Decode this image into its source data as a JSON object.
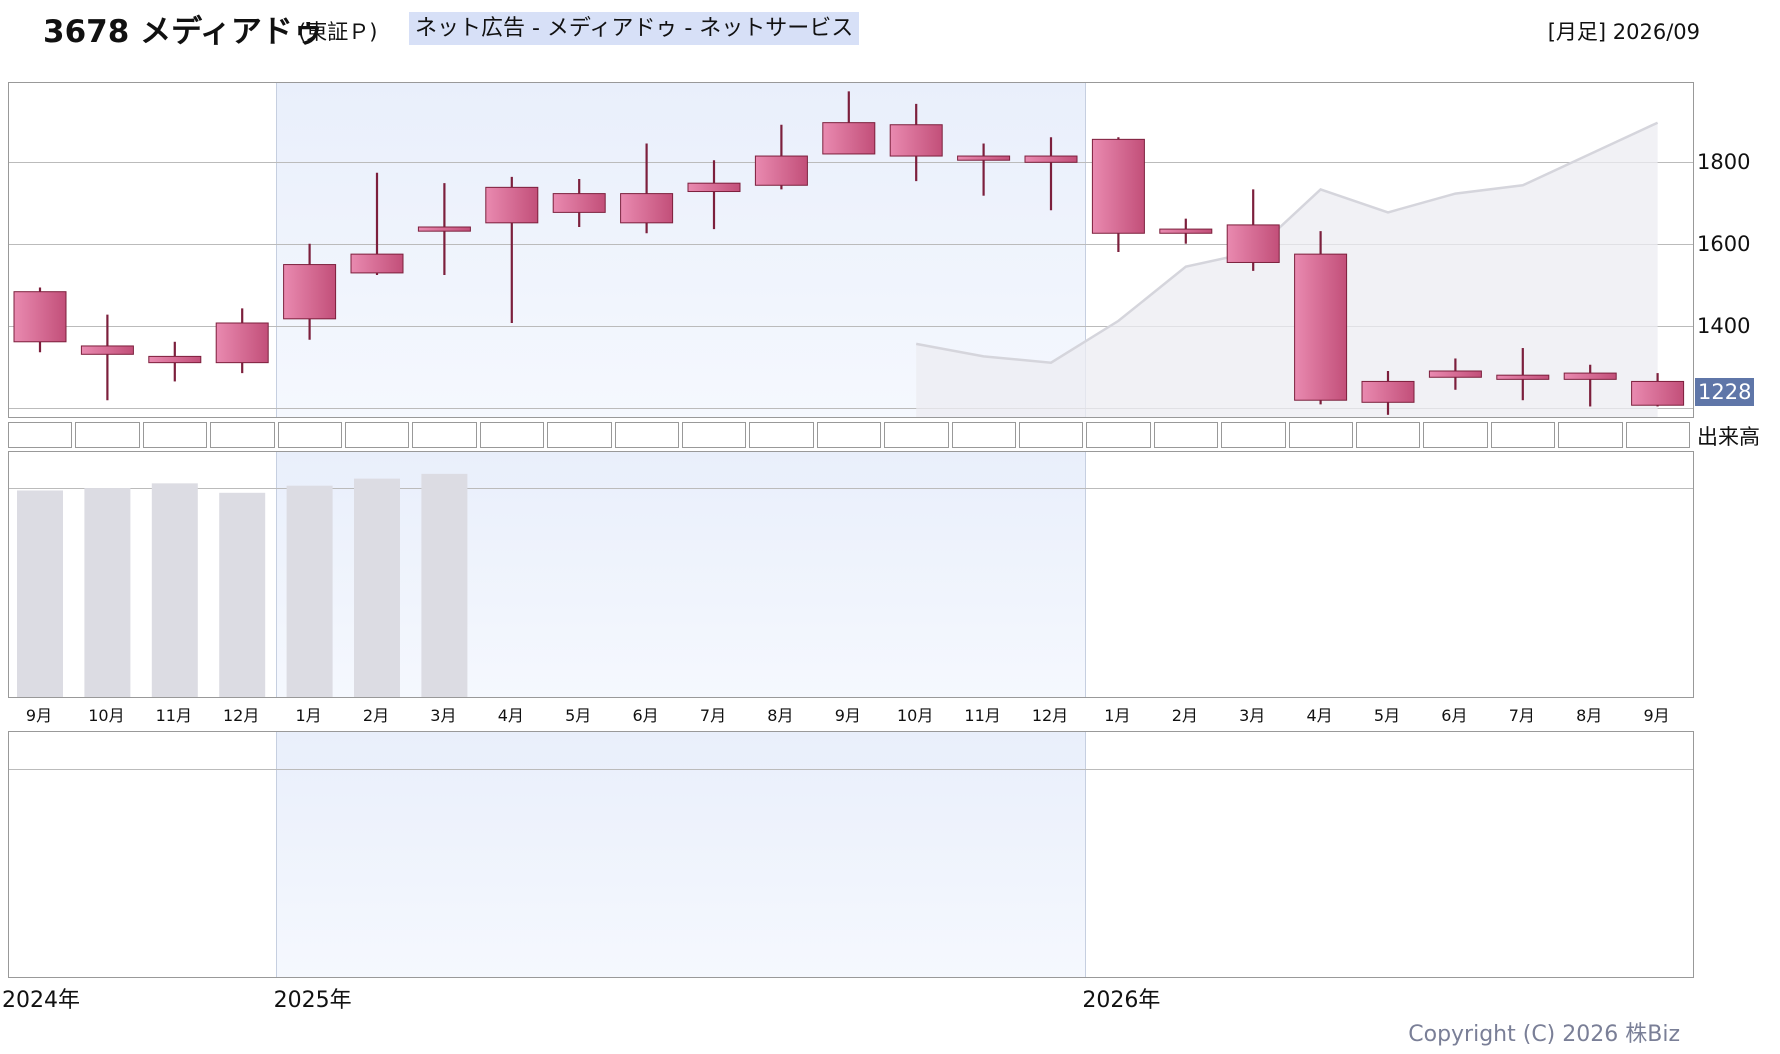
{
  "header": {
    "code_name": "3678 メディアドゥ",
    "market": "(東証Ｐ)",
    "sector": "ネット広告 - メディアドゥ - ネットサービス",
    "period": "[月足] 2026/09"
  },
  "chart_data": {
    "type": "candlestick",
    "months": [
      "9月",
      "10月",
      "11月",
      "12月",
      "1月",
      "2月",
      "3月",
      "4月",
      "5月",
      "6月",
      "7月",
      "8月",
      "9月",
      "10月",
      "11月",
      "12月",
      "1月",
      "2月",
      "3月",
      "4月",
      "5月",
      "6月",
      "7月",
      "8月",
      "9月"
    ],
    "years": [
      {
        "label": "2024年",
        "index": 0
      },
      {
        "label": "2025年",
        "index": 4
      },
      {
        "label": "2026年",
        "index": 16
      }
    ],
    "candles": [
      {
        "o": 1380,
        "h": 1510,
        "l": 1355,
        "c": 1500
      },
      {
        "o": 1350,
        "h": 1445,
        "l": 1240,
        "c": 1370
      },
      {
        "o": 1330,
        "h": 1380,
        "l": 1285,
        "c": 1345
      },
      {
        "o": 1330,
        "h": 1460,
        "l": 1305,
        "c": 1425
      },
      {
        "o": 1435,
        "h": 1615,
        "l": 1385,
        "c": 1565
      },
      {
        "o": 1545,
        "h": 1785,
        "l": 1540,
        "c": 1590
      },
      {
        "o": 1645,
        "h": 1760,
        "l": 1540,
        "c": 1655
      },
      {
        "o": 1665,
        "h": 1775,
        "l": 1425,
        "c": 1750
      },
      {
        "o": 1690,
        "h": 1770,
        "l": 1655,
        "c": 1735
      },
      {
        "o": 1665,
        "h": 1855,
        "l": 1640,
        "c": 1735
      },
      {
        "o": 1740,
        "h": 1815,
        "l": 1650,
        "c": 1760
      },
      {
        "o": 1755,
        "h": 1900,
        "l": 1745,
        "c": 1825
      },
      {
        "o": 1830,
        "h": 1980,
        "l": 1830,
        "c": 1905
      },
      {
        "o": 1825,
        "h": 1950,
        "l": 1765,
        "c": 1900
      },
      {
        "o": 1815,
        "h": 1855,
        "l": 1730,
        "c": 1825
      },
      {
        "o": 1810,
        "h": 1870,
        "l": 1695,
        "c": 1825
      },
      {
        "o": 1640,
        "h": 1870,
        "l": 1595,
        "c": 1865
      },
      {
        "o": 1640,
        "h": 1675,
        "l": 1615,
        "c": 1650
      },
      {
        "o": 1570,
        "h": 1745,
        "l": 1550,
        "c": 1660
      },
      {
        "o": 1240,
        "h": 1645,
        "l": 1230,
        "c": 1590
      },
      {
        "o": 1235,
        "h": 1310,
        "l": 1205,
        "c": 1285
      },
      {
        "o": 1295,
        "h": 1340,
        "l": 1265,
        "c": 1310
      },
      {
        "o": 1290,
        "h": 1365,
        "l": 1240,
        "c": 1300
      },
      {
        "o": 1290,
        "h": 1325,
        "l": 1225,
        "c": 1305
      },
      {
        "o": 1228,
        "h": 1305,
        "l": 1225,
        "c": 1285
      }
    ],
    "avg_line": [
      {
        "i": 13,
        "v": 1375
      },
      {
        "i": 14,
        "v": 1345
      },
      {
        "i": 15,
        "v": 1330
      },
      {
        "i": 16,
        "v": 1430
      },
      {
        "i": 17,
        "v": 1560
      },
      {
        "i": 18,
        "v": 1595
      },
      {
        "i": 19,
        "v": 1745
      },
      {
        "i": 20,
        "v": 1690
      },
      {
        "i": 21,
        "v": 1735
      },
      {
        "i": 22,
        "v": 1755
      },
      {
        "i": 23,
        "v": 1830
      },
      {
        "i": 24,
        "v": 1905
      }
    ],
    "yticks": [
      1800,
      1600,
      1400
    ],
    "ylim": [
      1195,
      2000
    ],
    "last_price": "1228",
    "volume_label": "出来高",
    "volume_relative": [
      0.88,
      0.89,
      0.91,
      0.87,
      0.9,
      0.93,
      0.95
    ],
    "colors": {
      "up": "#d9658f",
      "down": "#6f95d4",
      "up_wick": "#7c1f3c",
      "down_wick": "#22407f",
      "avg_fill": "#ececf1",
      "avg_line": "#d5d5dc",
      "volume": "#dcdce3"
    }
  },
  "footer": {
    "copyright": "Copyright (C) 2026 株Biz"
  }
}
